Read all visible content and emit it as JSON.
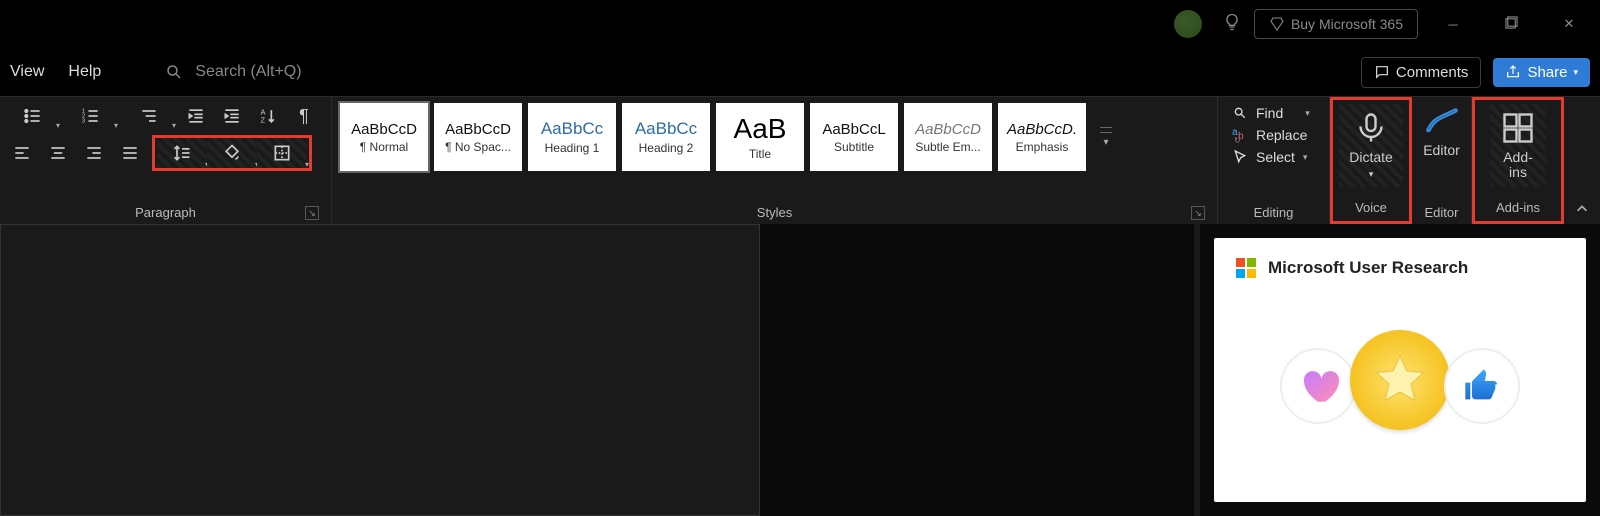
{
  "titlebar": {
    "buy_label": "Buy Microsoft 365"
  },
  "menubar": {
    "view": "View",
    "help": "Help",
    "search_placeholder": "Search (Alt+Q)",
    "comments": "Comments",
    "share": "Share"
  },
  "ribbon": {
    "paragraph": {
      "label": "Paragraph"
    },
    "styles": {
      "label": "Styles",
      "items": [
        {
          "preview": "AaBbCcD",
          "name": "¶ Normal",
          "variant": "normal",
          "selected": true
        },
        {
          "preview": "AaBbCcD",
          "name": "¶ No Spac...",
          "variant": "normal",
          "selected": false
        },
        {
          "preview": "AaBbCc",
          "name": "Heading 1",
          "variant": "heading",
          "selected": false
        },
        {
          "preview": "AaBbCc",
          "name": "Heading 2",
          "variant": "heading",
          "selected": false
        },
        {
          "preview": "AaB",
          "name": "Title",
          "variant": "title",
          "selected": false
        },
        {
          "preview": "AaBbCcL",
          "name": "Subtitle",
          "variant": "subtitle",
          "selected": false
        },
        {
          "preview": "AaBbCcD",
          "name": "Subtle Em...",
          "variant": "subtle",
          "selected": false
        },
        {
          "preview": "AaBbCcD.",
          "name": "Emphasis",
          "variant": "emph",
          "selected": false
        }
      ]
    },
    "editing": {
      "label": "Editing",
      "find": "Find",
      "replace": "Replace",
      "select": "Select"
    },
    "voice": {
      "label": "Voice",
      "dictate": "Dictate"
    },
    "editor": {
      "group_label": "Editor",
      "button": "Editor"
    },
    "addins": {
      "group_label": "Add-ins",
      "button": "Add-ins"
    }
  },
  "research_pane": {
    "title": "Microsoft User Research"
  }
}
